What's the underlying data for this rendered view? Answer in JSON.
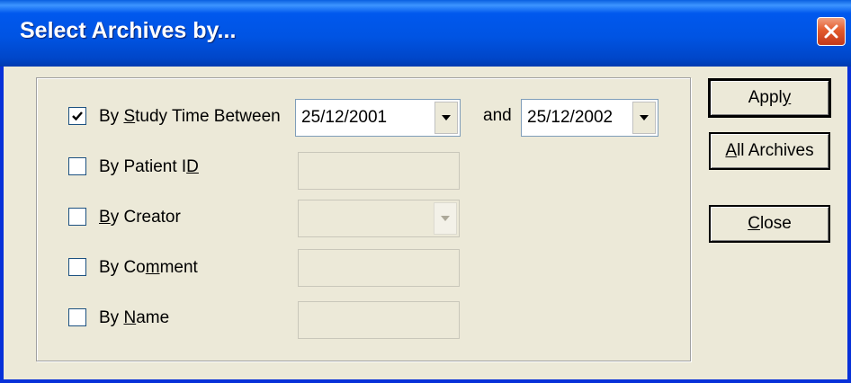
{
  "window": {
    "title": "Select Archives by..."
  },
  "rows": {
    "study_time": {
      "checked": true,
      "label_pre": "By ",
      "label_ul": "S",
      "label_post": "tudy Time Between"
    },
    "patient_id": {
      "checked": false,
      "label_pre": "By Patient I",
      "label_ul": "D",
      "label_post": ""
    },
    "creator": {
      "checked": false,
      "label_pre": "",
      "label_ul": "B",
      "label_post": "y Creator"
    },
    "comment": {
      "checked": false,
      "label_pre": "By Co",
      "label_ul": "m",
      "label_post": "ment"
    },
    "name": {
      "checked": false,
      "label_pre": "By ",
      "label_ul": "N",
      "label_post": "ame"
    }
  },
  "date_from": {
    "value": "25/12/2001"
  },
  "and_label": "and",
  "date_to": {
    "value": "25/12/2002"
  },
  "buttons": {
    "apply": {
      "pre": "Appl",
      "ul": "y",
      "post": ""
    },
    "all_archives": {
      "pre": "",
      "ul": "A",
      "post": "ll Archives"
    },
    "close": {
      "pre": "",
      "ul": "C",
      "post": "lose"
    }
  },
  "icons": {
    "close": "close-x-icon",
    "dropdown": "chevron-down-icon",
    "check": "checkmark-icon"
  },
  "colors": {
    "titlebar": "#0054e3",
    "dialog_bg": "#ece9d8",
    "close_button": "#e35b2c"
  }
}
